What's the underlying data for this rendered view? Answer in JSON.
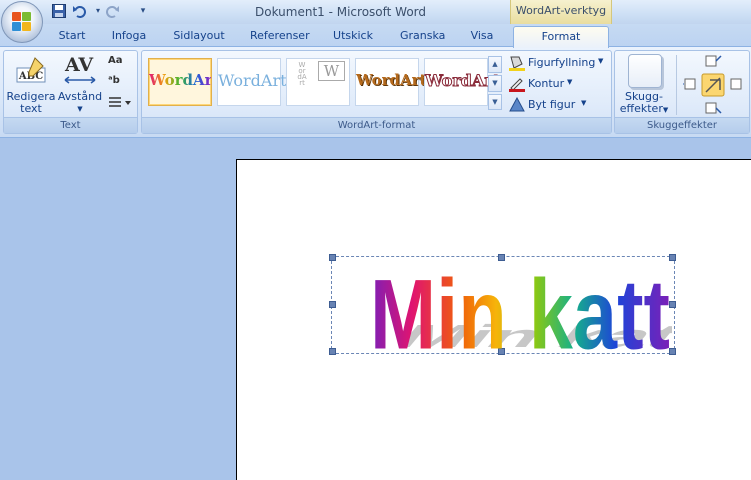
{
  "window": {
    "title": "Dokument1 - Microsoft Word",
    "contextual_title": "WordArt-verktyg"
  },
  "quick_access": {
    "icons": [
      "save-icon",
      "undo-icon",
      "redo-icon",
      "customize-icon"
    ]
  },
  "tabs": [
    {
      "label": "Start"
    },
    {
      "label": "Infoga"
    },
    {
      "label": "Sidlayout"
    },
    {
      "label": "Referenser"
    },
    {
      "label": "Utskick"
    },
    {
      "label": "Granska"
    },
    {
      "label": "Visa"
    },
    {
      "label": "Format",
      "active": true
    }
  ],
  "ribbon": {
    "text_group": {
      "label": "Text",
      "edit_text": "Redigera text",
      "edit_text_line1": "Redigera",
      "edit_text_line2": "text",
      "spacing": "Avstånd",
      "spacing_icon_text": "AV"
    },
    "wordart_group": {
      "label": "WordArt-format",
      "styles": [
        "WordArt",
        "WordArt",
        "WordArt",
        "WordArt",
        "WordArt"
      ],
      "shape_fill": "Figurfyllning",
      "outline": "Kontur",
      "change_shape": "Byt figur"
    },
    "shadow_group": {
      "label": "Skuggeffekter",
      "button_line1": "Skugg-",
      "button_line2": "effekter"
    }
  },
  "document": {
    "wordart_text": "Min katt"
  },
  "colors": {
    "ribbon_bg": "#dbe8f9",
    "workspace_bg": "#a9c4ea",
    "contextual_tab": "#e9dd9f",
    "text_blue": "#15428b"
  }
}
